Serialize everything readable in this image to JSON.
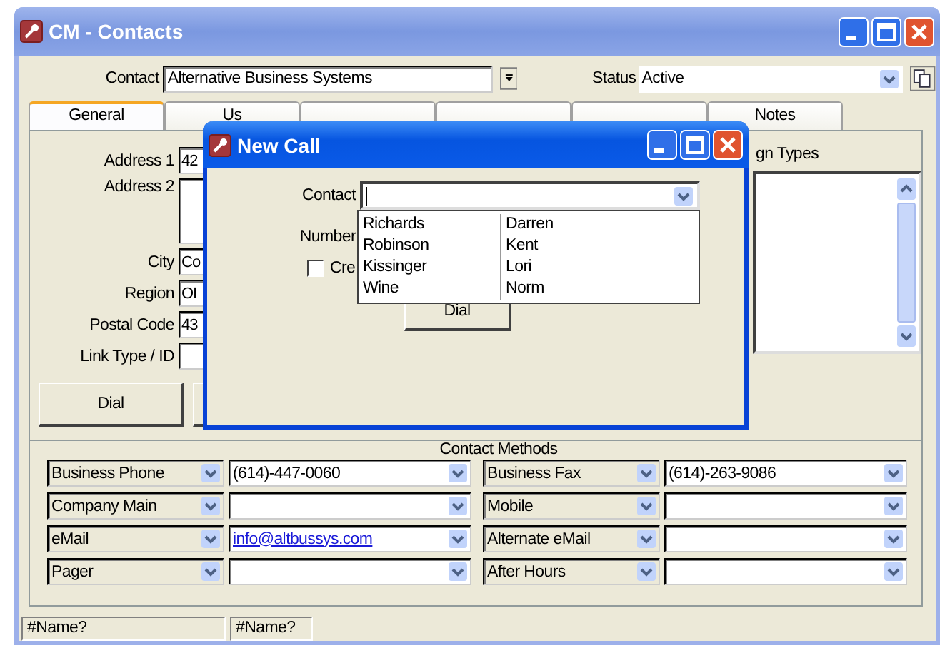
{
  "window": {
    "title": "CM - Contacts"
  },
  "header": {
    "contact_label": "Contact",
    "contact_value": "Alternative Business Systems",
    "status_label": "Status",
    "status_value": "Active"
  },
  "tabs": [
    {
      "label": "General",
      "selected": true
    },
    {
      "label": "Us",
      "selected": false
    },
    {
      "selected": false
    },
    {
      "selected": false
    },
    {
      "selected": false
    },
    {
      "label": "Notes",
      "selected": false
    }
  ],
  "address": {
    "fields": [
      {
        "label": "Address 1",
        "value": "42",
        "kind": "line"
      },
      {
        "label": "Address 2",
        "kind": "multiline"
      },
      {
        "label": "City",
        "value": "Co",
        "kind": "line"
      },
      {
        "label": "Region",
        "value": "OI",
        "kind": "line"
      },
      {
        "label": "Postal Code",
        "value": "43",
        "kind": "line"
      },
      {
        "label": "Link Type / ID",
        "kind": "line"
      }
    ],
    "buttons": [
      {
        "label": "Dial",
        "kind": "labeled"
      },
      {
        "kind": "blank"
      }
    ]
  },
  "design_types": {
    "label": "gn Types"
  },
  "contact_methods": {
    "title": "Contact Methods",
    "rows": [
      {
        "type": "Business Phone",
        "value": "(614)-447-0060",
        "kind": "text"
      },
      {
        "type": "Business Fax",
        "value": "(614)-263-9086",
        "kind": "text"
      },
      {
        "type": "Company Main",
        "kind": "text"
      },
      {
        "type": "Mobile",
        "kind": "text"
      },
      {
        "type": "eMail",
        "value": "info@altbussys.com",
        "kind": "link"
      },
      {
        "type": "Alternate eMail",
        "kind": "text"
      },
      {
        "type": "Pager",
        "kind": "text"
      },
      {
        "type": "After Hours",
        "kind": "text"
      }
    ]
  },
  "status_bar": [
    "#Name?",
    "#Name?"
  ],
  "dialog": {
    "title": "New Call",
    "contact_label": "Contact",
    "number_label": "Number",
    "checkbox": {
      "label": "Cre",
      "checked": false
    },
    "button": "Dial",
    "dropdown": [
      {
        "last": "Richards",
        "first": "Darren"
      },
      {
        "last": "Robinson",
        "first": "Kent"
      },
      {
        "last": "Kissinger",
        "first": "Lori"
      },
      {
        "last": "Wine",
        "first": "Norm"
      }
    ]
  }
}
